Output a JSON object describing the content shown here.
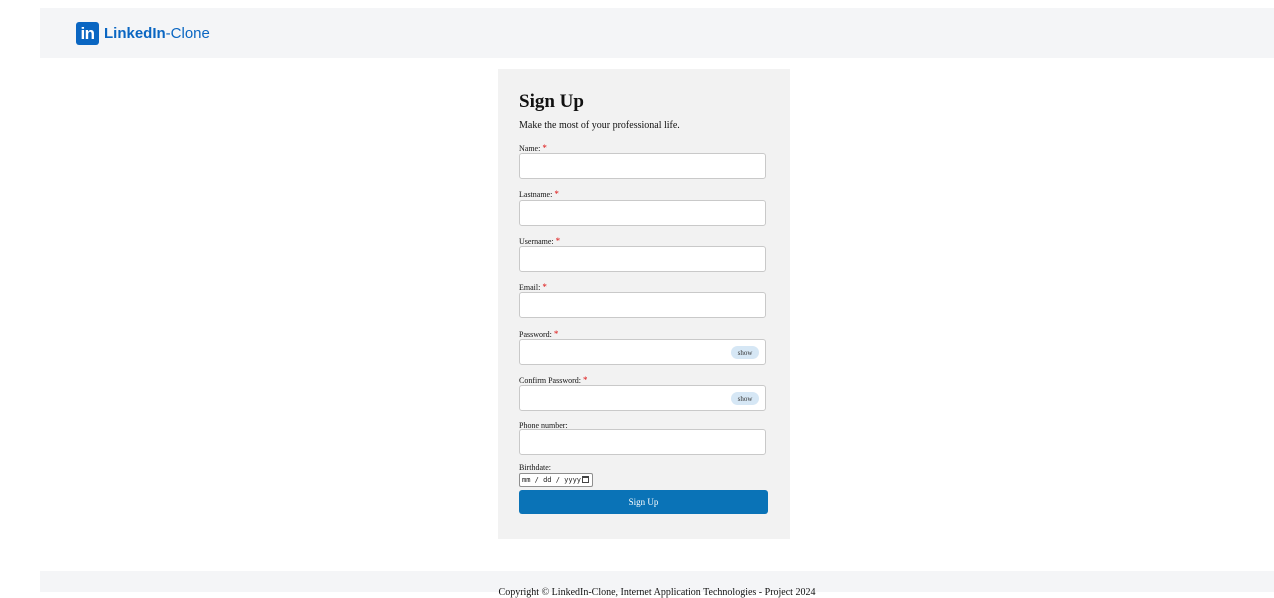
{
  "header": {
    "logo_icon_text": "in",
    "brand_bold": "LinkedIn",
    "brand_suffix": "-Clone",
    "brand_color": "#0a66c2"
  },
  "form": {
    "title": "Sign Up",
    "subtitle": "Make the most of your professional life.",
    "required_marker": "*",
    "fields": {
      "name": "Name:",
      "lastname": "Lastname:",
      "username": "Username:",
      "email": "Email:",
      "password": "Password:",
      "confirm_password": "Confirm Password:",
      "phone": "Phone number:",
      "birthdate": "Birthdate:"
    },
    "show_label": "show",
    "date_placeholder": "mm / dd / yyyy",
    "submit_label": "Sign Up",
    "submit_color": "#0a73b7"
  },
  "footer": {
    "text": "Copyright © LinkedIn-Clone, Internet Application Technologies - Project 2024"
  }
}
